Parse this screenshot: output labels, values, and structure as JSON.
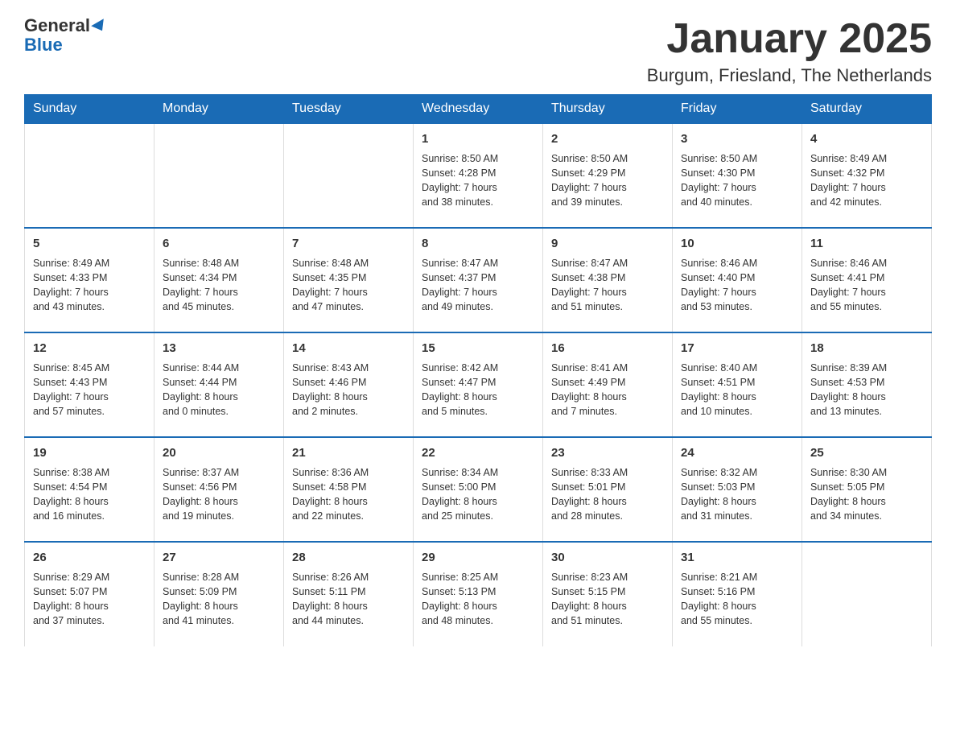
{
  "header": {
    "logo_general": "General",
    "logo_blue": "Blue",
    "month_title": "January 2025",
    "location": "Burgum, Friesland, The Netherlands"
  },
  "days_of_week": [
    "Sunday",
    "Monday",
    "Tuesday",
    "Wednesday",
    "Thursday",
    "Friday",
    "Saturday"
  ],
  "weeks": [
    [
      {
        "day": "",
        "info": ""
      },
      {
        "day": "",
        "info": ""
      },
      {
        "day": "",
        "info": ""
      },
      {
        "day": "1",
        "info": "Sunrise: 8:50 AM\nSunset: 4:28 PM\nDaylight: 7 hours\nand 38 minutes."
      },
      {
        "day": "2",
        "info": "Sunrise: 8:50 AM\nSunset: 4:29 PM\nDaylight: 7 hours\nand 39 minutes."
      },
      {
        "day": "3",
        "info": "Sunrise: 8:50 AM\nSunset: 4:30 PM\nDaylight: 7 hours\nand 40 minutes."
      },
      {
        "day": "4",
        "info": "Sunrise: 8:49 AM\nSunset: 4:32 PM\nDaylight: 7 hours\nand 42 minutes."
      }
    ],
    [
      {
        "day": "5",
        "info": "Sunrise: 8:49 AM\nSunset: 4:33 PM\nDaylight: 7 hours\nand 43 minutes."
      },
      {
        "day": "6",
        "info": "Sunrise: 8:48 AM\nSunset: 4:34 PM\nDaylight: 7 hours\nand 45 minutes."
      },
      {
        "day": "7",
        "info": "Sunrise: 8:48 AM\nSunset: 4:35 PM\nDaylight: 7 hours\nand 47 minutes."
      },
      {
        "day": "8",
        "info": "Sunrise: 8:47 AM\nSunset: 4:37 PM\nDaylight: 7 hours\nand 49 minutes."
      },
      {
        "day": "9",
        "info": "Sunrise: 8:47 AM\nSunset: 4:38 PM\nDaylight: 7 hours\nand 51 minutes."
      },
      {
        "day": "10",
        "info": "Sunrise: 8:46 AM\nSunset: 4:40 PM\nDaylight: 7 hours\nand 53 minutes."
      },
      {
        "day": "11",
        "info": "Sunrise: 8:46 AM\nSunset: 4:41 PM\nDaylight: 7 hours\nand 55 minutes."
      }
    ],
    [
      {
        "day": "12",
        "info": "Sunrise: 8:45 AM\nSunset: 4:43 PM\nDaylight: 7 hours\nand 57 minutes."
      },
      {
        "day": "13",
        "info": "Sunrise: 8:44 AM\nSunset: 4:44 PM\nDaylight: 8 hours\nand 0 minutes."
      },
      {
        "day": "14",
        "info": "Sunrise: 8:43 AM\nSunset: 4:46 PM\nDaylight: 8 hours\nand 2 minutes."
      },
      {
        "day": "15",
        "info": "Sunrise: 8:42 AM\nSunset: 4:47 PM\nDaylight: 8 hours\nand 5 minutes."
      },
      {
        "day": "16",
        "info": "Sunrise: 8:41 AM\nSunset: 4:49 PM\nDaylight: 8 hours\nand 7 minutes."
      },
      {
        "day": "17",
        "info": "Sunrise: 8:40 AM\nSunset: 4:51 PM\nDaylight: 8 hours\nand 10 minutes."
      },
      {
        "day": "18",
        "info": "Sunrise: 8:39 AM\nSunset: 4:53 PM\nDaylight: 8 hours\nand 13 minutes."
      }
    ],
    [
      {
        "day": "19",
        "info": "Sunrise: 8:38 AM\nSunset: 4:54 PM\nDaylight: 8 hours\nand 16 minutes."
      },
      {
        "day": "20",
        "info": "Sunrise: 8:37 AM\nSunset: 4:56 PM\nDaylight: 8 hours\nand 19 minutes."
      },
      {
        "day": "21",
        "info": "Sunrise: 8:36 AM\nSunset: 4:58 PM\nDaylight: 8 hours\nand 22 minutes."
      },
      {
        "day": "22",
        "info": "Sunrise: 8:34 AM\nSunset: 5:00 PM\nDaylight: 8 hours\nand 25 minutes."
      },
      {
        "day": "23",
        "info": "Sunrise: 8:33 AM\nSunset: 5:01 PM\nDaylight: 8 hours\nand 28 minutes."
      },
      {
        "day": "24",
        "info": "Sunrise: 8:32 AM\nSunset: 5:03 PM\nDaylight: 8 hours\nand 31 minutes."
      },
      {
        "day": "25",
        "info": "Sunrise: 8:30 AM\nSunset: 5:05 PM\nDaylight: 8 hours\nand 34 minutes."
      }
    ],
    [
      {
        "day": "26",
        "info": "Sunrise: 8:29 AM\nSunset: 5:07 PM\nDaylight: 8 hours\nand 37 minutes."
      },
      {
        "day": "27",
        "info": "Sunrise: 8:28 AM\nSunset: 5:09 PM\nDaylight: 8 hours\nand 41 minutes."
      },
      {
        "day": "28",
        "info": "Sunrise: 8:26 AM\nSunset: 5:11 PM\nDaylight: 8 hours\nand 44 minutes."
      },
      {
        "day": "29",
        "info": "Sunrise: 8:25 AM\nSunset: 5:13 PM\nDaylight: 8 hours\nand 48 minutes."
      },
      {
        "day": "30",
        "info": "Sunrise: 8:23 AM\nSunset: 5:15 PM\nDaylight: 8 hours\nand 51 minutes."
      },
      {
        "day": "31",
        "info": "Sunrise: 8:21 AM\nSunset: 5:16 PM\nDaylight: 8 hours\nand 55 minutes."
      },
      {
        "day": "",
        "info": ""
      }
    ]
  ]
}
